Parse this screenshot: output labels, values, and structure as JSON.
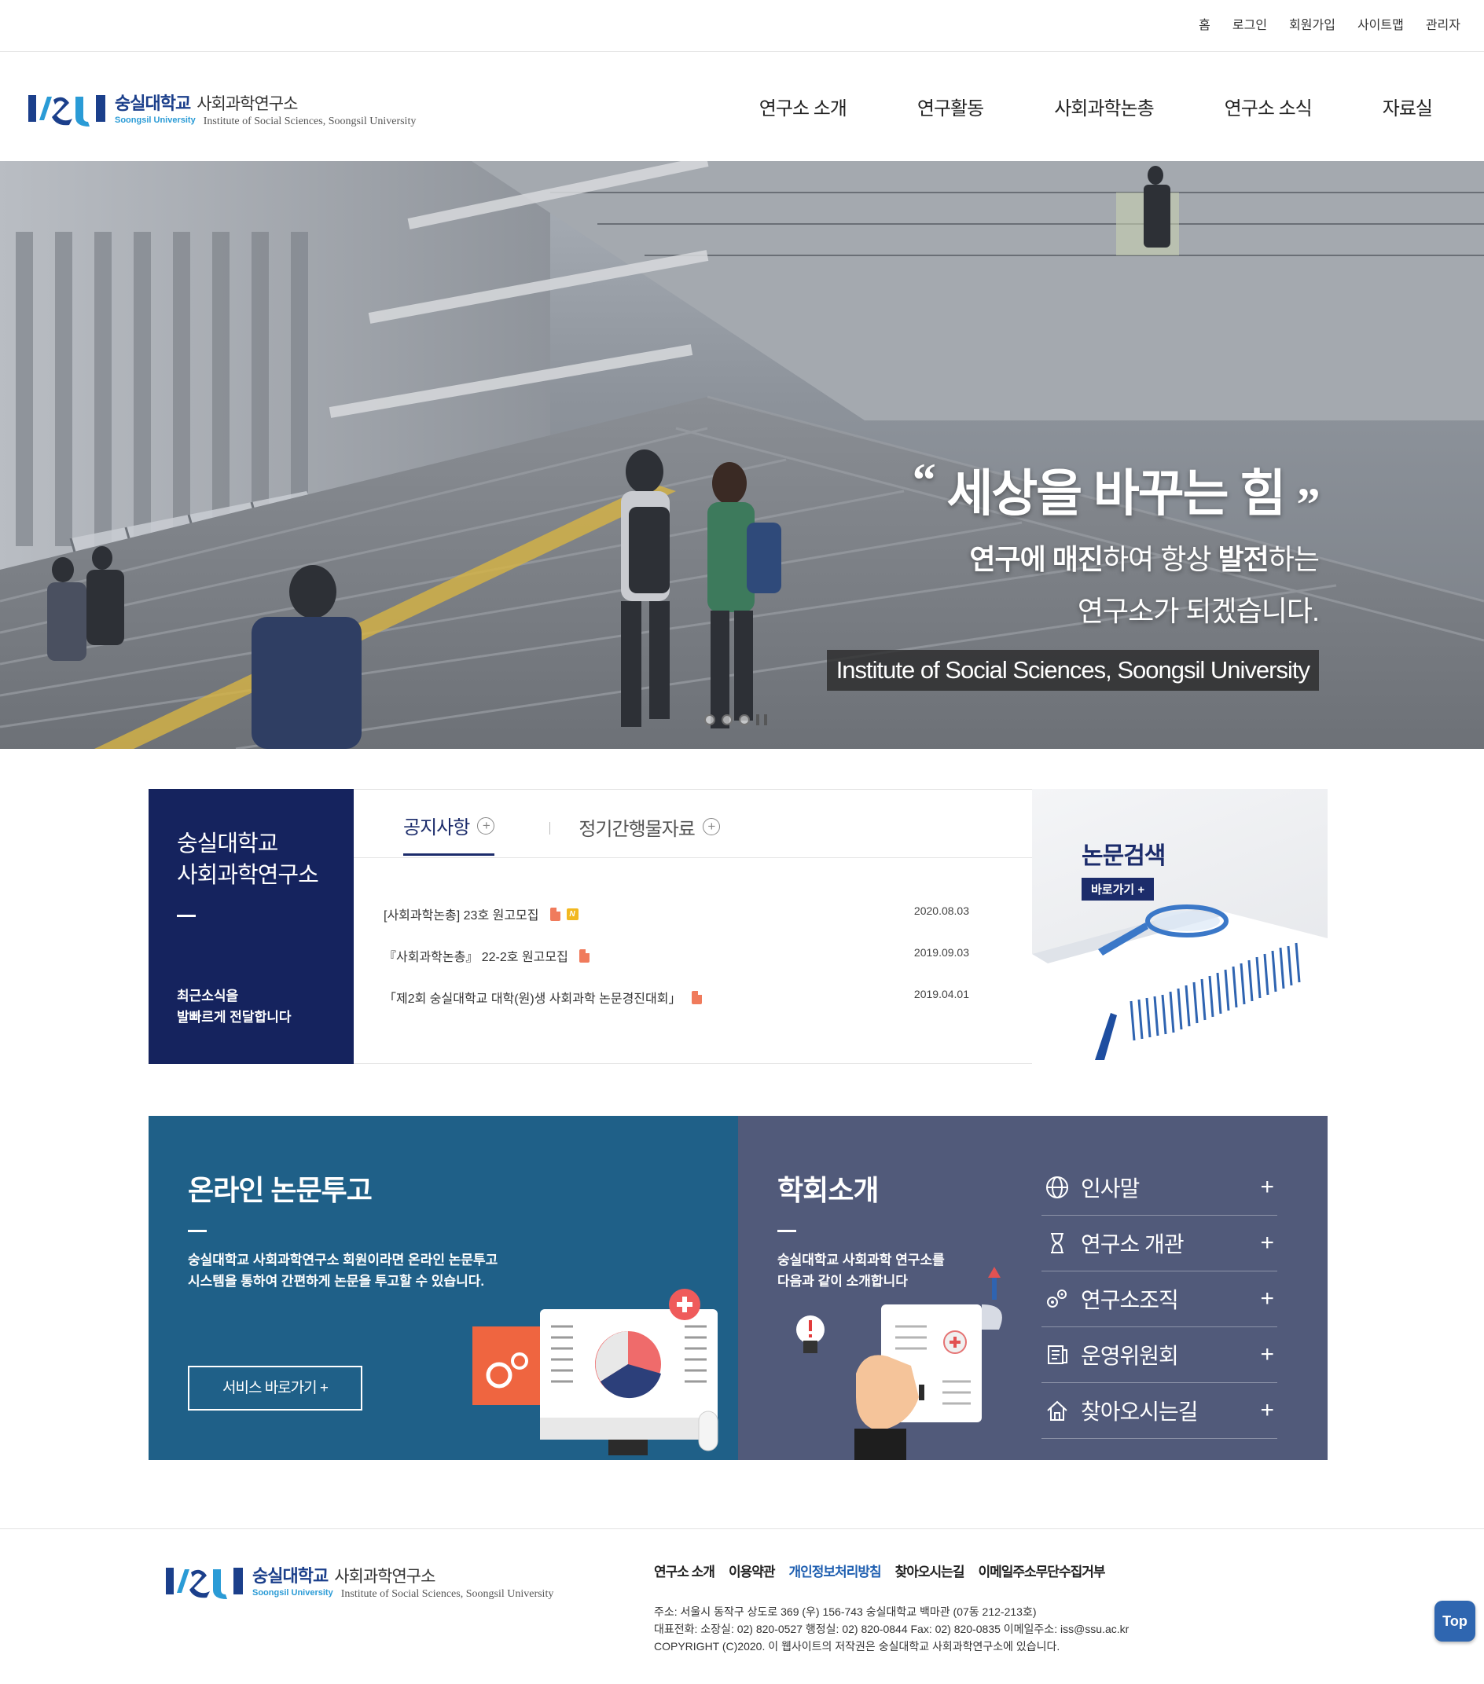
{
  "util_nav": [
    "홈",
    "로그인",
    "회원가입",
    "사이트맵",
    "관리자"
  ],
  "logo": {
    "univ": "숭실대학교",
    "univ_en": "Soongsil University",
    "inst": "사회과학연구소",
    "inst_en": "Institute of Social Sciences, Soongsil University"
  },
  "gnb": [
    "연구소 소개",
    "연구활동",
    "사회과학논총",
    "연구소 소식",
    "자료실"
  ],
  "hero": {
    "title": "세상을 바꾸는 힘",
    "line1_a": "연구에 매진",
    "line1_b": "하여 항상 ",
    "line1_c": "발전",
    "line1_d": "하는",
    "line2": "연구소가 되겠습니다.",
    "badge": "Institute of Social Sciences, Soongsil University"
  },
  "notice_intro": {
    "title1": "숭실대학교",
    "title2": "사회과학연구소",
    "desc1": "최근소식을",
    "desc2": "발빠르게 전달합니다"
  },
  "tabs": [
    "공지사항",
    "정기간행물자료"
  ],
  "notices": [
    {
      "title": "[사회과학논총] 23호 원고모집",
      "date": "2020.08.03",
      "new": "N"
    },
    {
      "title": "『사회과학논총』 22-2호 원고모집",
      "date": "2019.09.03"
    },
    {
      "title": "「제2회 숭실대학교 대학(원)생 사회과학 논문경진대회」",
      "date": "2019.04.01"
    }
  ],
  "search_card": {
    "title": "논문검색",
    "button": "바로가기 +"
  },
  "online_panel": {
    "title": "온라인 논문투고",
    "desc1": "숭실대학교 사회과학연구소 회원이라면 온라인 논문투고",
    "desc2": "시스템을 통하여 간편하게 논문을 투고할 수 있습니다.",
    "button": "서비스 바로가기 +"
  },
  "intro_panel": {
    "title": "학회소개",
    "desc1": "숭실대학교 사회과학 연구소를",
    "desc2": "다음과 같이 소개합니다",
    "menu": [
      {
        "label": "인사말",
        "icon": "globe-icon"
      },
      {
        "label": "연구소 개관",
        "icon": "hourglass-icon"
      },
      {
        "label": "연구소조직",
        "icon": "gears-icon"
      },
      {
        "label": "운영위원회",
        "icon": "document-icon"
      },
      {
        "label": "찾아오시는길",
        "icon": "home-icon"
      }
    ],
    "plus": "+"
  },
  "footer": {
    "links": [
      "연구소 소개",
      "이용약관",
      "개인정보처리방침",
      "찾아오시는길",
      "이메일주소무단수집거부"
    ],
    "address": "주소: 서울시 동작구 상도로 369 (우) 156-743 숭실대학교 백마관 (07동 212-213호)",
    "phone": "대표전화: 소장실: 02) 820-0527 행정실: 02) 820-0844 Fax: 02) 820-0835 이메일주소: iss@ssu.ac.kr",
    "copyright": "COPYRIGHT (C)2020. 이 웹사이트의 저작권은 숭실대학교 사회과학연구소에 있습니다."
  },
  "top_button": "Top",
  "colors": {
    "navy": "#15235e",
    "blue_panel": "#1f6088",
    "slate_panel": "#515a7a",
    "link_highlight": "#1f5fb0"
  }
}
